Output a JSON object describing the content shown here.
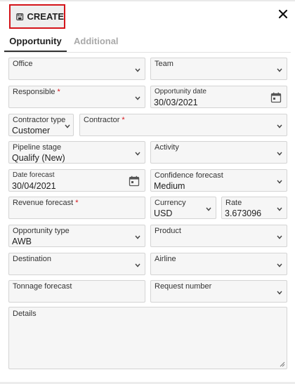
{
  "toolbar": {
    "create_label": "CREATE"
  },
  "tabs": [
    {
      "label": "Opportunity",
      "active": true
    },
    {
      "label": "Additional",
      "active": false
    }
  ],
  "form": {
    "office": {
      "label": "Office",
      "value": ""
    },
    "team": {
      "label": "Team",
      "value": ""
    },
    "responsible": {
      "label": "Responsible",
      "required_mark": "*",
      "value": ""
    },
    "opportunity_date": {
      "label": "Opportunity date",
      "value": "30/03/2021"
    },
    "contractor_type": {
      "label": "Contractor type",
      "value": "Customer"
    },
    "contractor": {
      "label": "Contractor",
      "required_mark": "*",
      "value": ""
    },
    "pipeline_stage": {
      "label": "Pipeline stage",
      "value": "Qualify (New)"
    },
    "activity": {
      "label": "Activity",
      "value": ""
    },
    "date_forecast": {
      "label": "Date forecast",
      "value": "30/04/2021"
    },
    "confidence_forecast": {
      "label": "Confidence forecast",
      "value": "Medium"
    },
    "revenue_forecast": {
      "label": "Revenue forecast",
      "required_mark": "*",
      "value": ""
    },
    "currency": {
      "label": "Currency",
      "value": "USD"
    },
    "rate": {
      "label": "Rate",
      "value": "3.673096"
    },
    "opportunity_type": {
      "label": "Opportunity type",
      "value": "AWB"
    },
    "product": {
      "label": "Product",
      "value": ""
    },
    "destination": {
      "label": "Destination",
      "value": ""
    },
    "airline": {
      "label": "Airline",
      "value": ""
    },
    "tonnage_forecast": {
      "label": "Tonnage forecast",
      "value": ""
    },
    "request_number": {
      "label": "Request number",
      "value": ""
    },
    "details": {
      "label": "Details",
      "value": ""
    }
  },
  "colors": {
    "required": "#d4141a",
    "highlight_border": "#d4141a",
    "field_bg": "#f6f6f6"
  }
}
